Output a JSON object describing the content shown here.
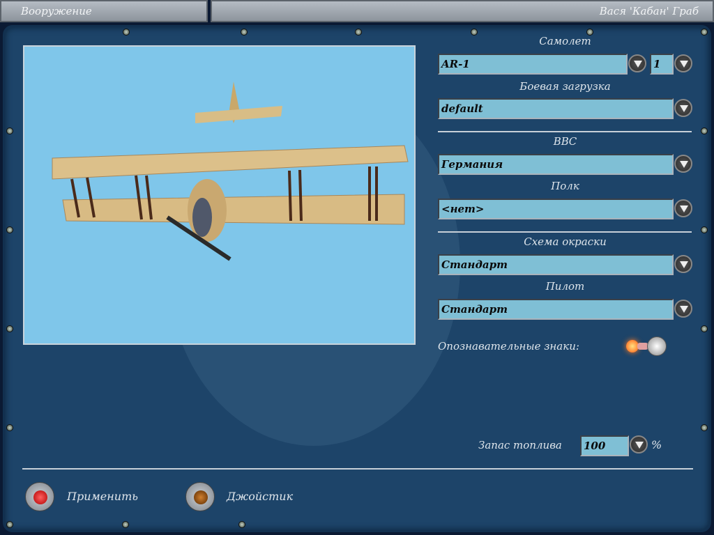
{
  "header": {
    "section_tab": "Вооружение",
    "pilot_name": "Вася 'Кабан' Граб"
  },
  "aircraft": {
    "label": "Самолет",
    "value": "AR-1",
    "count": "1"
  },
  "loadout": {
    "label": "Боевая загрузка",
    "value": "default"
  },
  "air_force": {
    "label": "ВВС",
    "value": "Германия"
  },
  "regiment": {
    "label": "Полк",
    "value": "<нет>"
  },
  "skin": {
    "label": "Схема окраски",
    "value": "Стандарт"
  },
  "pilot": {
    "label": "Пилот",
    "value": "Стандарт"
  },
  "markings": {
    "label": "Опознавательные знаки:",
    "enabled": true
  },
  "fuel": {
    "label": "Запас топлива",
    "value": "100",
    "unit": "%"
  },
  "buttons": {
    "apply": "Применить",
    "joystick": "Джойстик"
  }
}
